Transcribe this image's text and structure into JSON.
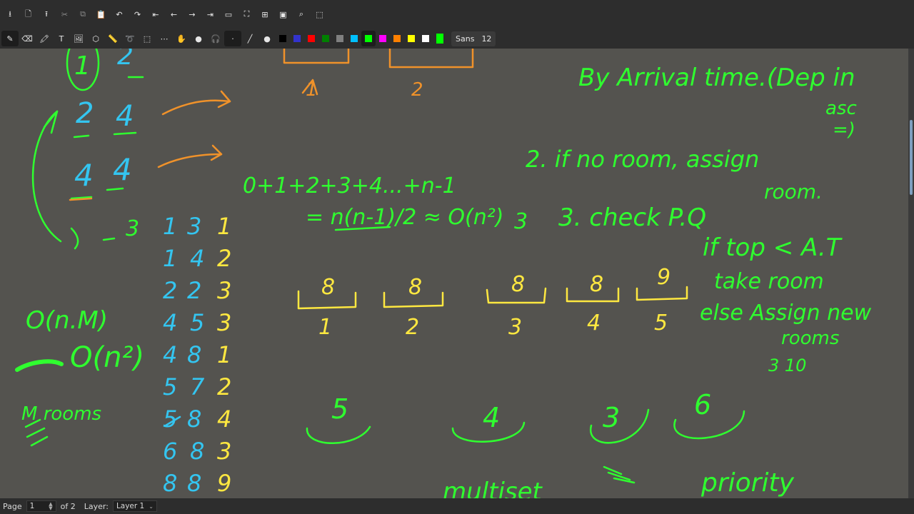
{
  "toolbar_main": {
    "buttons": [
      {
        "name": "save-icon",
        "glyph": "⭳"
      },
      {
        "name": "new-page-icon",
        "glyph": "🗋"
      },
      {
        "name": "export-icon",
        "glyph": "⭱"
      },
      {
        "name": "cut-icon",
        "glyph": "✂"
      },
      {
        "name": "copy-icon",
        "glyph": "⧉"
      },
      {
        "name": "paste-icon",
        "glyph": "📋"
      },
      {
        "name": "undo-icon",
        "glyph": "↶"
      },
      {
        "name": "redo-icon",
        "glyph": "↷"
      },
      {
        "name": "first-page-icon",
        "glyph": "⇤"
      },
      {
        "name": "previous-page-icon",
        "glyph": "←"
      },
      {
        "name": "next-page-icon",
        "glyph": "→"
      },
      {
        "name": "last-page-icon",
        "glyph": "⇥"
      },
      {
        "name": "zoom-out-icon",
        "glyph": "▭"
      },
      {
        "name": "zoom-fit-icon",
        "glyph": "⛶"
      },
      {
        "name": "zoom-in-icon",
        "glyph": "⊞"
      },
      {
        "name": "zoom-100-icon",
        "glyph": "▣"
      },
      {
        "name": "search-icon",
        "glyph": "⌕"
      },
      {
        "name": "fullscreen-icon",
        "glyph": "⬚"
      }
    ]
  },
  "toolbar_tools": {
    "tools": [
      {
        "name": "pen-tool-icon",
        "glyph": "✎"
      },
      {
        "name": "eraser-tool-icon",
        "glyph": "⌫"
      },
      {
        "name": "highlighter-tool-icon",
        "glyph": "🖍"
      },
      {
        "name": "text-tool-icon",
        "glyph": "T"
      },
      {
        "name": "image-tool-icon",
        "glyph": "🖼"
      },
      {
        "name": "shapes-tool-icon",
        "glyph": "⬡"
      },
      {
        "name": "ruler-tool-icon",
        "glyph": "📏"
      },
      {
        "name": "lasso-select-icon",
        "glyph": "➰"
      },
      {
        "name": "rect-select-icon",
        "glyph": "⬚"
      },
      {
        "name": "vertical-space-icon",
        "glyph": "⋯"
      },
      {
        "name": "hand-tool-icon",
        "glyph": "✋"
      },
      {
        "name": "play-object-icon",
        "glyph": "●"
      },
      {
        "name": "audio-icon",
        "glyph": "🎧"
      },
      {
        "name": "line-width-icon",
        "glyph": "·"
      },
      {
        "name": "line-style-icon",
        "glyph": "╱"
      },
      {
        "name": "fill-icon",
        "glyph": "●"
      }
    ],
    "colors": [
      "#000000",
      "#3333cc",
      "#ff0000",
      "#008000",
      "#808080",
      "#00c0ff",
      "#00ff00",
      "#ff00ff",
      "#ff8000",
      "#ffff00",
      "#ffffff"
    ],
    "current_color": "#00ff00",
    "font_label": "Sans",
    "font_size": "12"
  },
  "statusbar": {
    "page_label": "Page",
    "page_value": "1",
    "page_of": "of 2",
    "layer_label": "Layer:",
    "layer_value": "Layer 1"
  },
  "notes": {
    "colors": {
      "green": "#2fff2f",
      "blue": "#34c5f0",
      "yellow": "#ffe840",
      "orange": "#f0922a"
    },
    "top_left_numbers": [
      "1",
      "2"
    ],
    "left_pairs": [
      [
        "2",
        "4"
      ],
      [
        "4",
        "4"
      ]
    ],
    "left_paren_row": [
      "3"
    ],
    "complexity_left": [
      "O(n.M)",
      "O(n²)",
      "M rooms"
    ],
    "table_rows": [
      [
        "1",
        "3",
        "1"
      ],
      [
        "1",
        "4",
        "2"
      ],
      [
        "2",
        "2",
        "3"
      ],
      [
        "4",
        "5",
        "3"
      ],
      [
        "4",
        "8",
        "1"
      ],
      [
        "5",
        "7",
        "2"
      ],
      [
        "5",
        "8",
        "4"
      ],
      [
        "6",
        "8",
        "3"
      ],
      [
        "8",
        "8",
        "9"
      ]
    ],
    "orange_boxes": [
      "1",
      "2"
    ],
    "sum_formula": "0+1+2+3+4...+n-1",
    "sum_result": "= n(n-1)/2 ≈ O(n²)",
    "step3": [
      "3",
      "3. check P.Q"
    ],
    "rooms_top_values": [
      "8",
      "8",
      "8",
      "8",
      "9"
    ],
    "rooms_bottom_labels": [
      "1",
      "2",
      "3",
      "4",
      "5"
    ],
    "rooms_lower_values": [
      "5",
      "4",
      "3",
      "6"
    ],
    "right_notes": [
      "By Arrival time.(Dep in",
      "asc",
      "=)",
      "2. if no room, assign",
      "room.",
      "if top < A.T",
      "take room",
      "else Assign new",
      "rooms",
      "3 10"
    ],
    "bottom_words": [
      "multiset",
      "priority"
    ]
  }
}
